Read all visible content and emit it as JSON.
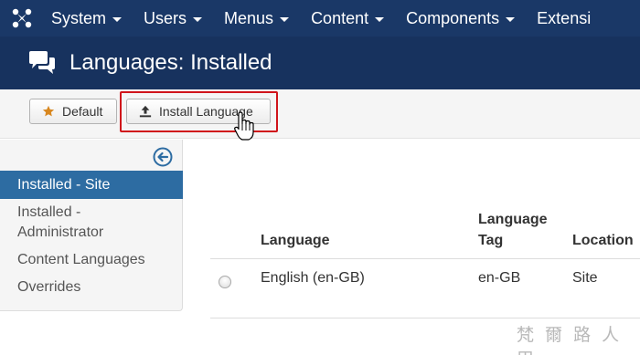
{
  "navbar": {
    "logo_icon": "joomla-logo-icon",
    "items": [
      {
        "label": "System"
      },
      {
        "label": "Users"
      },
      {
        "label": "Menus"
      },
      {
        "label": "Content"
      },
      {
        "label": "Components"
      },
      {
        "label": "Extensi"
      }
    ]
  },
  "header": {
    "icon": "comments-icon",
    "title": "Languages: Installed"
  },
  "toolbar": {
    "default_label": "Default",
    "default_icon": "star-icon",
    "install_label": "Install Language",
    "install_icon": "upload-icon"
  },
  "sidebar": {
    "collapse_icon": "arrow-left-circle-icon",
    "items": [
      {
        "label": "Installed - Site",
        "active": true
      },
      {
        "label_line1": "Installed -",
        "label_line2": "Administrator"
      },
      {
        "label": "Content Languages"
      },
      {
        "label": "Overrides"
      }
    ]
  },
  "table": {
    "headers": {
      "language": "Language",
      "tag_line1": "Language",
      "tag_line2": "Tag",
      "location": "Location"
    },
    "rows": [
      {
        "language": "English (en-GB)",
        "tag": "en-GB",
        "location": "Site"
      }
    ]
  },
  "watermark": "梵 爾 路 人 甲",
  "colors": {
    "navbar": "#1a3867",
    "titlebar": "#17325e",
    "sidebar_active": "#2d6ca2",
    "highlight": "#d0141b"
  }
}
